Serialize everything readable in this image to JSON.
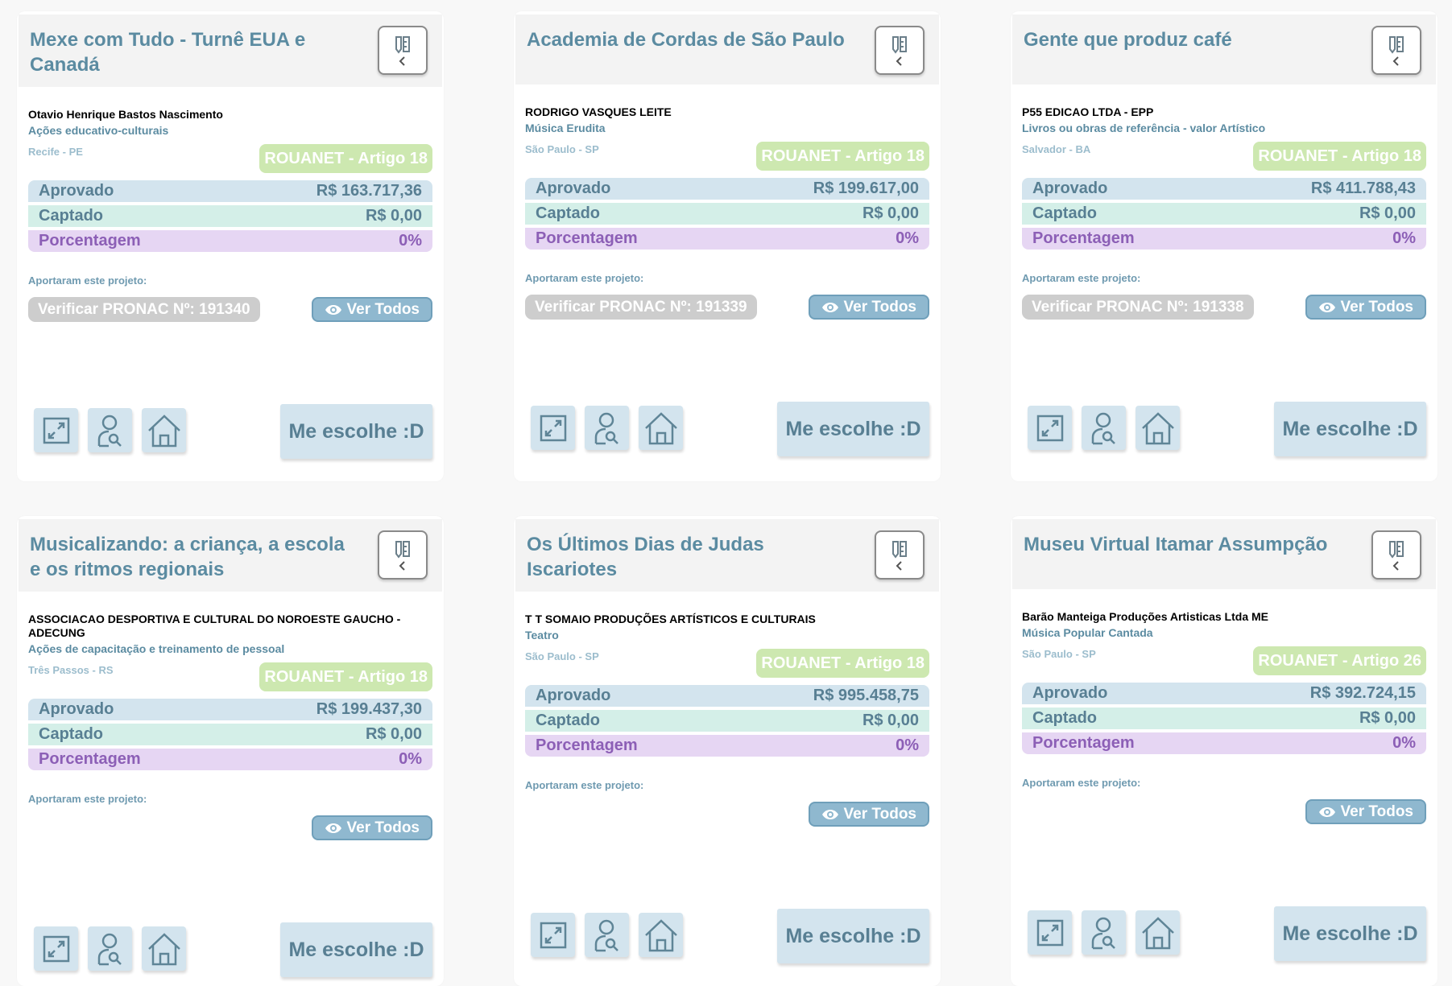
{
  "labels": {
    "aprovado": "Aprovado",
    "captado": "Captado",
    "porcentagem": "Porcentagem",
    "aportaram": "Aportaram este projeto:",
    "ver_todos": "Ver Todos",
    "me_escolhe": "Me escolhe :D"
  },
  "colors": {
    "title": "#5b8ba1",
    "badge": "#cde8b0",
    "aprovado": "#d3e4ee",
    "captado": "#d4efe8",
    "porcentagem": "#e6d6f3"
  },
  "cards": [
    {
      "title": "Mexe com Tudo - Turnê EUA e Canadá",
      "proponent": "Otavio Henrique Bastos Nascimento",
      "category": "Ações educativo-culturais",
      "location": "Recife - PE",
      "badge": "ROUANET - Artigo 18",
      "aprovado": "R$ 163.717,36",
      "captado": "R$ 0,00",
      "porcentagem": "0%",
      "pronac": "Verificar PRONAC Nº: 191340"
    },
    {
      "title": "Academia de Cordas de São Paulo",
      "proponent": "RODRIGO VASQUES LEITE",
      "category": "Música Erudita",
      "location": "São Paulo - SP",
      "badge": "ROUANET - Artigo 18",
      "aprovado": "R$ 199.617,00",
      "captado": "R$ 0,00",
      "porcentagem": "0%",
      "pronac": "Verificar PRONAC Nº: 191339"
    },
    {
      "title": "Gente que produz café",
      "proponent": "P55 EDICAO LTDA - EPP",
      "category": "Livros ou obras de referência - valor Artístico",
      "location": "Salvador - BA",
      "badge": "ROUANET - Artigo 18",
      "aprovado": "R$ 411.788,43",
      "captado": "R$ 0,00",
      "porcentagem": "0%",
      "pronac": "Verificar PRONAC Nº: 191338"
    },
    {
      "title": "Musicalizando: a criança, a escola e os ritmos regionais",
      "proponent": "ASSOCIACAO DESPORTIVA E CULTURAL DO NOROESTE GAUCHO - ADECUNG",
      "category": "Ações de capacitação e treinamento de pessoal",
      "location": "Três Passos - RS",
      "badge": "ROUANET - Artigo 18",
      "aprovado": "R$ 199.437,30",
      "captado": "R$ 0,00",
      "porcentagem": "0%"
    },
    {
      "title": "Os Últimos Dias de Judas Iscariotes",
      "proponent": "T T SOMAIO PRODUÇÕES ARTÍSTICOS E CULTURAIS",
      "category": "Teatro",
      "location": "São Paulo - SP",
      "badge": "ROUANET - Artigo 18",
      "aprovado": "R$ 995.458,75",
      "captado": "R$ 0,00",
      "porcentagem": "0%"
    },
    {
      "title": "Museu Virtual Itamar Assumpção",
      "proponent": "Barão Manteiga Produções Artisticas Ltda ME",
      "category": "Música Popular Cantada",
      "location": "São Paulo - SP",
      "badge": "ROUANET - Artigo 26",
      "aprovado": "R$ 392.724,15",
      "captado": "R$ 0,00",
      "porcentagem": "0%"
    }
  ]
}
